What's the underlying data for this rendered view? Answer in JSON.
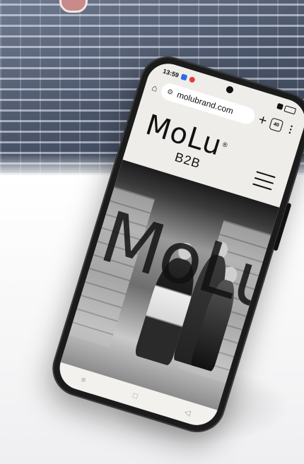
{
  "status_bar": {
    "time": "13:59"
  },
  "browser": {
    "url": "molubrand.com",
    "tab_count": "40",
    "new_tab_symbol": "+",
    "menu_symbol": "⋮"
  },
  "site": {
    "logo_text": "MoLu",
    "logo_mark": "®",
    "logo_subtitle": "B2B",
    "hero_overlay": "MoLu"
  },
  "icons": {
    "home": "home-icon",
    "tune": "tune-icon",
    "menu": "hamburger-menu-icon",
    "nav_recent": "recent-apps-icon",
    "nav_home": "home-button-icon",
    "nav_back": "back-icon"
  },
  "colors": {
    "screen_bg": "#efedea",
    "phone_body": "#1b1b1b"
  }
}
